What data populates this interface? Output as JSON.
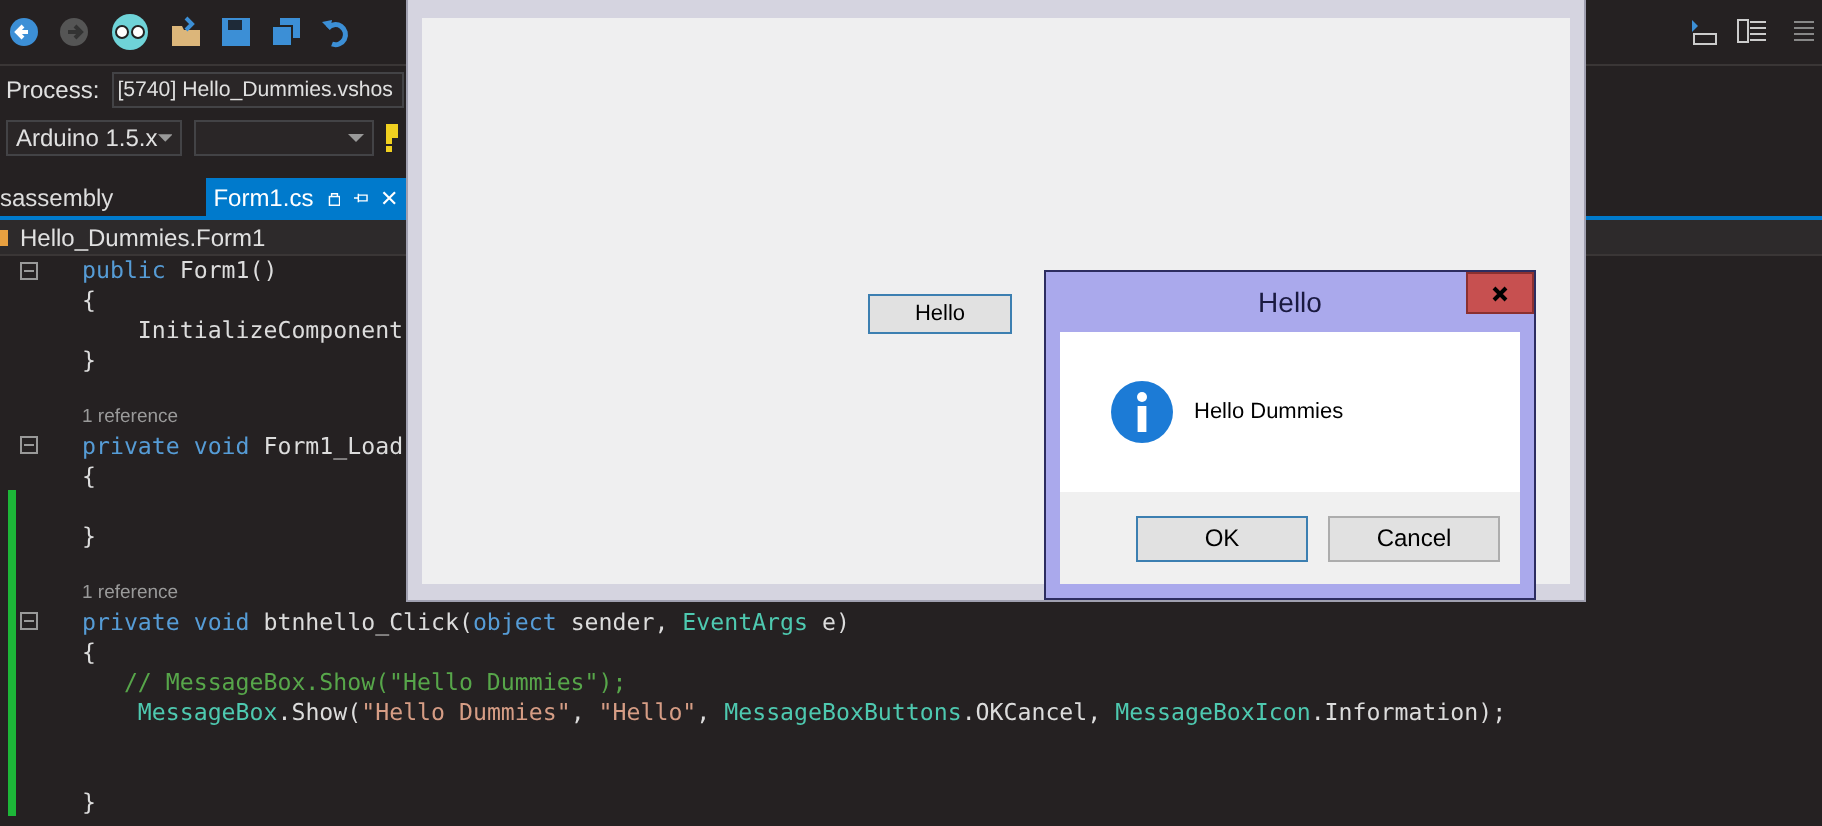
{
  "process": {
    "label": "Process:",
    "value": "[5740] Hello_Dummies.vshos"
  },
  "config": {
    "platform": "Arduino 1.5.x"
  },
  "tabs": [
    {
      "label": "sassembly",
      "selected": false
    },
    {
      "label": "Form1.cs",
      "selected": true
    }
  ],
  "nav": {
    "class": "Hello_Dummies.Form1"
  },
  "code_lines": [
    {
      "kind": "code",
      "collapsible": true,
      "changed": false,
      "tokens": [
        {
          "kind": "keyword",
          "text": "public"
        },
        {
          "kind": "plain",
          "text": " Form1()"
        }
      ]
    },
    {
      "kind": "code",
      "collapsible": false,
      "changed": false,
      "tokens": [
        {
          "kind": "plain",
          "text": "{"
        }
      ]
    },
    {
      "kind": "code",
      "collapsible": false,
      "changed": false,
      "tokens": [
        {
          "kind": "plain",
          "text": "    InitializeComponent"
        }
      ]
    },
    {
      "kind": "code",
      "collapsible": false,
      "changed": false,
      "tokens": [
        {
          "kind": "plain",
          "text": "}"
        }
      ]
    },
    {
      "kind": "blank",
      "collapsible": false,
      "changed": false
    },
    {
      "kind": "reference",
      "collapsible": false,
      "changed": false,
      "tokens": [
        {
          "kind": "plain",
          "text": "1 reference"
        }
      ]
    },
    {
      "kind": "code",
      "collapsible": true,
      "changed": false,
      "tokens": [
        {
          "kind": "keyword",
          "text": "private void"
        },
        {
          "kind": "plain",
          "text": " Form1_Load"
        }
      ]
    },
    {
      "kind": "code",
      "collapsible": false,
      "changed": false,
      "tokens": [
        {
          "kind": "plain",
          "text": "{"
        }
      ]
    },
    {
      "kind": "blank",
      "collapsible": false,
      "changed": true
    },
    {
      "kind": "code",
      "collapsible": false,
      "changed": true,
      "tokens": [
        {
          "kind": "plain",
          "text": "}"
        }
      ]
    },
    {
      "kind": "blank",
      "collapsible": false,
      "changed": true
    },
    {
      "kind": "reference",
      "collapsible": false,
      "changed": true,
      "tokens": [
        {
          "kind": "plain",
          "text": "1 reference"
        }
      ]
    },
    {
      "kind": "code",
      "collapsible": true,
      "changed": true,
      "tokens": [
        {
          "kind": "keyword",
          "text": "private void"
        },
        {
          "kind": "plain",
          "text": " btnhello_Click("
        },
        {
          "kind": "keyword",
          "text": "object"
        },
        {
          "kind": "plain",
          "text": " sender, "
        },
        {
          "kind": "type",
          "text": "EventArgs"
        },
        {
          "kind": "plain",
          "text": " e)"
        }
      ]
    },
    {
      "kind": "code",
      "collapsible": false,
      "changed": true,
      "tokens": [
        {
          "kind": "plain",
          "text": "{"
        }
      ]
    },
    {
      "kind": "code",
      "collapsible": false,
      "changed": true,
      "tokens": [
        {
          "kind": "comment",
          "text": "   // MessageBox.Show(\"Hello Dummies\");"
        }
      ]
    },
    {
      "kind": "code",
      "collapsible": false,
      "changed": true,
      "tokens": [
        {
          "kind": "type",
          "text": "    MessageBox"
        },
        {
          "kind": "plain",
          "text": ".Show("
        },
        {
          "kind": "string",
          "text": "\"Hello Dummies\""
        },
        {
          "kind": "plain",
          "text": ", "
        },
        {
          "kind": "string",
          "text": "\"Hello\""
        },
        {
          "kind": "plain",
          "text": ", "
        },
        {
          "kind": "type",
          "text": "MessageBoxButtons"
        },
        {
          "kind": "plain",
          "text": ".OKCancel, "
        },
        {
          "kind": "type",
          "text": "MessageBoxIcon"
        },
        {
          "kind": "plain",
          "text": ".Information);"
        }
      ]
    },
    {
      "kind": "blank",
      "collapsible": false,
      "changed": true
    },
    {
      "kind": "blank",
      "collapsible": false,
      "changed": true
    },
    {
      "kind": "code",
      "collapsible": false,
      "changed": true,
      "tokens": [
        {
          "kind": "plain",
          "text": "}"
        }
      ]
    }
  ],
  "form_window": {
    "button": "Hello"
  },
  "message_box": {
    "title": "Hello",
    "message": "Hello Dummies",
    "buttons": [
      "OK",
      "Cancel"
    ]
  }
}
